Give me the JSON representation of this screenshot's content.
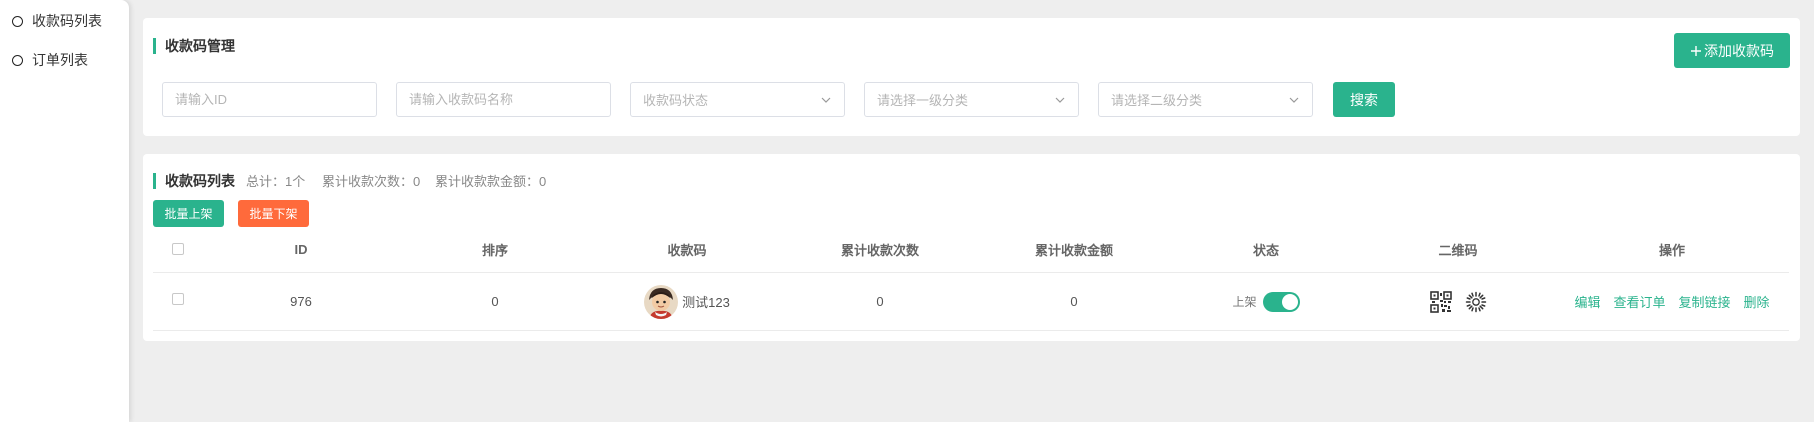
{
  "colors": {
    "accent": "#2ab38d",
    "danger": "#ff6a3b",
    "page_bg": "#eeeeee"
  },
  "sidebar": {
    "items": [
      {
        "label": "收款码列表",
        "icon": "radio-icon"
      },
      {
        "label": "订单列表",
        "icon": "radio-icon"
      }
    ]
  },
  "manage_panel": {
    "title": "收款码管理",
    "add_button": {
      "icon": "plus-icon",
      "label": "添加收款码"
    },
    "filters": {
      "id_placeholder": "请输入ID",
      "name_placeholder": "请输入收款码名称",
      "status_placeholder": "收款码状态",
      "category1_placeholder": "请选择一级分类",
      "category2_placeholder": "请选择二级分类"
    },
    "search_button": "搜索"
  },
  "list_panel": {
    "title": "收款码列表",
    "stats": {
      "total": "总计：1个",
      "count": "累计收款次数：0",
      "amount": "累计收款款金额：0"
    },
    "batch_on_button": "批量上架",
    "batch_off_button": "批量下架",
    "columns": [
      "ID",
      "排序",
      "收款码",
      "累计收款次数",
      "累计收款金额",
      "状态",
      "二维码",
      "操作"
    ],
    "rows": [
      {
        "id": "976",
        "sort": "0",
        "avatar": "avatar-image",
        "name": "测试123",
        "count": "0",
        "amount": "0",
        "status_label": "上架",
        "status_on": true,
        "qr_icons": [
          "qr-code-icon",
          "mini-program-code-icon"
        ],
        "actions": [
          "编辑",
          "查看订单",
          "复制链接",
          "删除"
        ]
      }
    ]
  }
}
